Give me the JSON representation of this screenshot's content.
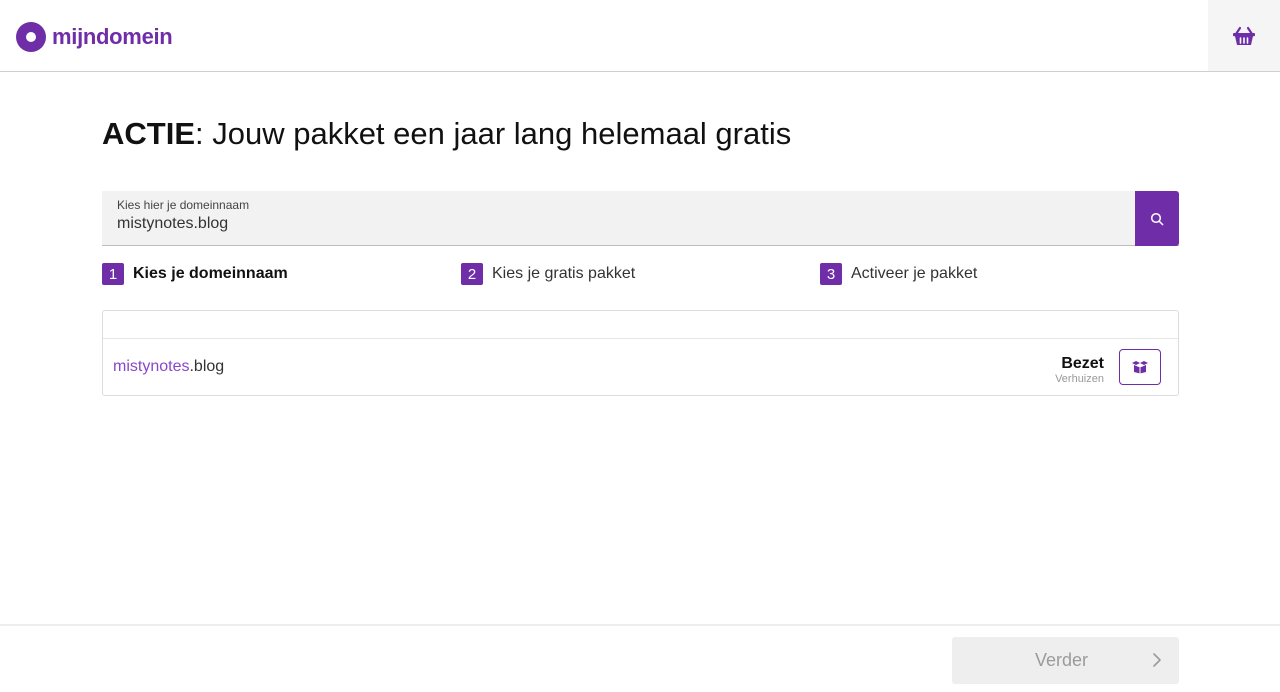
{
  "header": {
    "logo_text": "mijndomein",
    "basket_icon": "basket-icon"
  },
  "page": {
    "title_strong": "ACTIE",
    "title_rest": ": Jouw pakket een jaar lang helemaal gratis"
  },
  "search": {
    "label": "Kies hier je domeinnaam",
    "value": "mistynotes.blog",
    "button_icon": "search-icon"
  },
  "steps": [
    {
      "number": "1",
      "label": "Kies je domeinnaam",
      "active": true
    },
    {
      "number": "2",
      "label": "Kies je gratis pakket",
      "active": false
    },
    {
      "number": "3",
      "label": "Activeer je pakket",
      "active": false
    }
  ],
  "results": [
    {
      "domain_name": "mistynotes",
      "domain_ext": ".blog",
      "status": "Bezet",
      "sub_status": "Verhuizen",
      "action_icon": "moving-box-icon"
    }
  ],
  "footer": {
    "next_label": "Verder",
    "next_icon": "chevron-right-icon"
  },
  "colors": {
    "brand": "#6f2da8",
    "domain_name": "#8a47c7",
    "disabled_button": "#eeeeee"
  }
}
